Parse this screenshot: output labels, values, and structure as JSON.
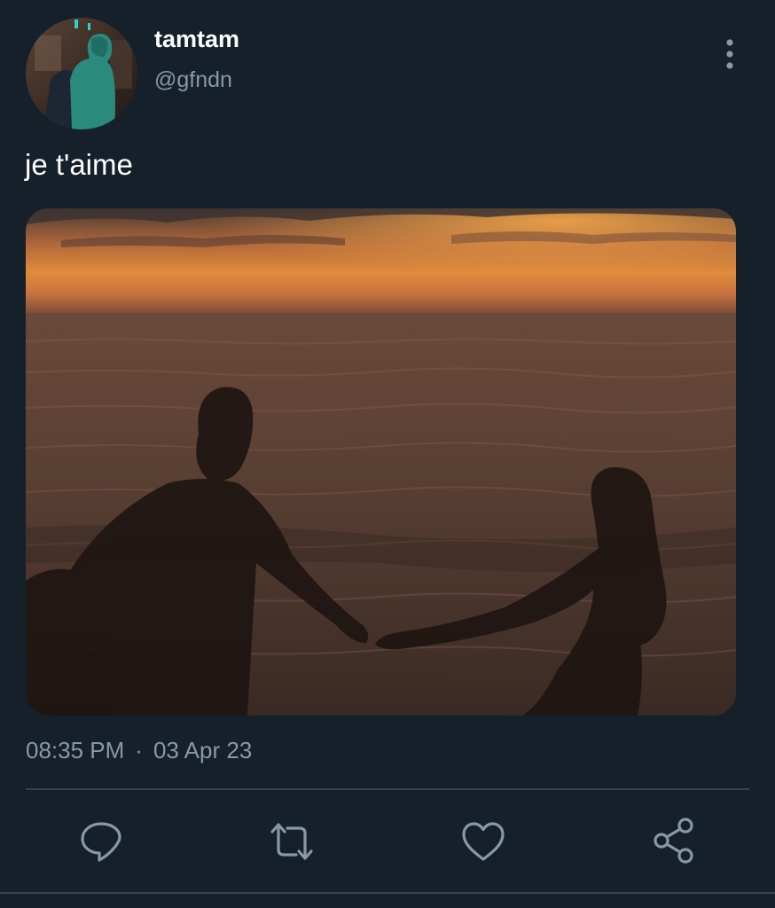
{
  "tweet": {
    "author": {
      "display_name": "tamtam",
      "handle": "@gfndn"
    },
    "text": "je t'aime",
    "time": "08:35 PM",
    "separator": "·",
    "date": "03 Apr 23"
  },
  "icons": {
    "more": "more-vertical-icon",
    "reply": "reply-icon",
    "retweet": "retweet-icon",
    "like": "heart-icon",
    "share": "share-icon"
  },
  "colors": {
    "background": "#15202b",
    "secondary_text": "#8899a6",
    "divider": "#38444d",
    "primary_text": "#ffffff"
  }
}
